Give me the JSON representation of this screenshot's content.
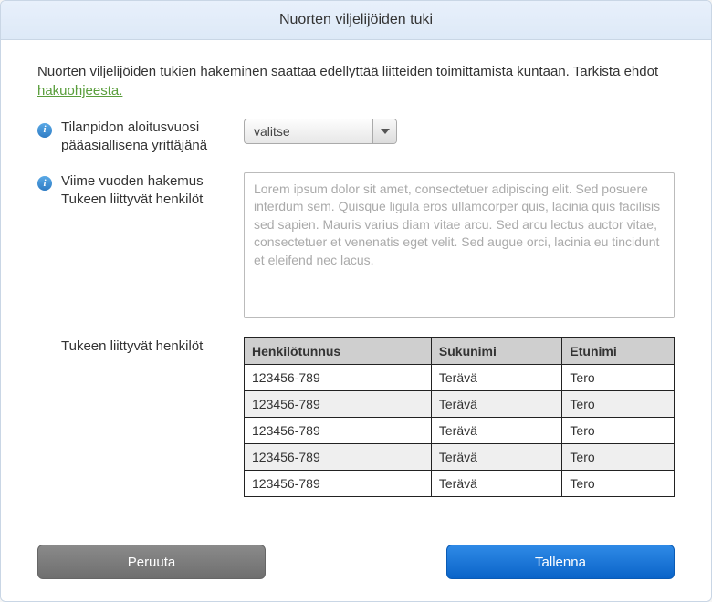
{
  "header": {
    "title": "Nuorten viljelijöiden tuki"
  },
  "intro": {
    "text_before_link": "Nuorten viljelijöiden tukien hakeminen saattaa edellyttää liitteiden toimittamista kuntaan. Tarkista ehdot ",
    "link_text": "hakuohjeesta."
  },
  "fields": {
    "start_year": {
      "label": "Tilanpidon aloitusvuosi pääasiallisena yrittäjänä",
      "selected": "valitse"
    },
    "last_year_app": {
      "label_line1": "Viime vuoden hakemus",
      "label_line2": "Tukeen liittyvät henkilöt",
      "value": "Lorem ipsum dolor sit amet, consectetuer adipiscing elit. Sed posuere interdum sem. Quisque ligula eros ullamcorper quis, lacinia quis facilisis sed sapien. Mauris varius diam vitae arcu. Sed arcu lectus auctor vitae, consectetuer et venenatis eget velit. Sed augue orci, lacinia eu tincidunt et eleifend nec lacus."
    },
    "persons": {
      "label": "Tukeen liittyvät henkilöt",
      "columns": {
        "ssn": "Henkilötunnus",
        "lastname": "Sukunimi",
        "firstname": "Etunimi"
      },
      "rows": [
        {
          "ssn": "123456-789",
          "lastname": "Terävä",
          "firstname": "Tero"
        },
        {
          "ssn": "123456-789",
          "lastname": "Terävä",
          "firstname": "Tero"
        },
        {
          "ssn": "123456-789",
          "lastname": "Terävä",
          "firstname": "Tero"
        },
        {
          "ssn": "123456-789",
          "lastname": "Terävä",
          "firstname": "Tero"
        },
        {
          "ssn": "123456-789",
          "lastname": "Terävä",
          "firstname": "Tero"
        }
      ]
    }
  },
  "buttons": {
    "cancel": "Peruuta",
    "save": "Tallenna"
  }
}
